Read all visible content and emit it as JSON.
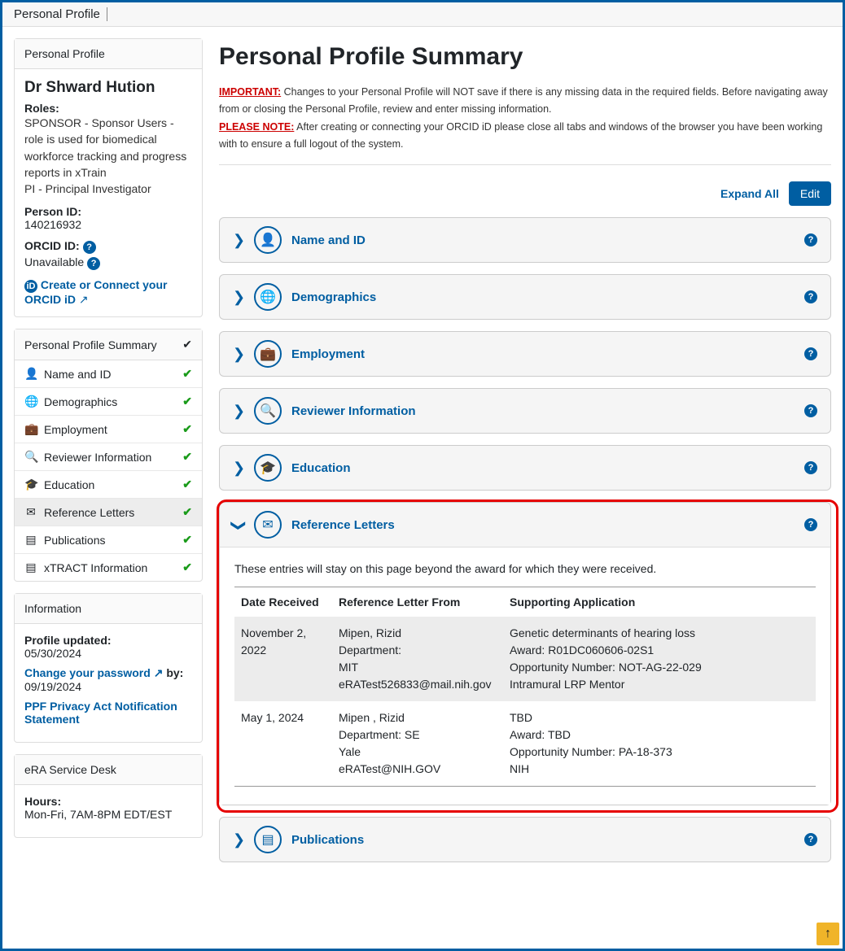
{
  "topbar": {
    "title": "Personal Profile"
  },
  "profile": {
    "header": "Personal Profile",
    "name": "Dr Shward Hution",
    "roles_label": "Roles:",
    "roles_text": "SPONSOR - Sponsor Users - role is used for biomedical workforce tracking and progress reports in xTrain\nPI - Principal Investigator",
    "person_id_label": "Person ID:",
    "person_id": "140216932",
    "orcid_label": "ORCID ID:",
    "orcid_status": "Unavailable",
    "orcid_link": "Create or Connect your ORCID iD"
  },
  "nav": {
    "header": "Personal Profile Summary",
    "items": [
      {
        "label": "Name and ID",
        "icon": "user-icon"
      },
      {
        "label": "Demographics",
        "icon": "globe-icon"
      },
      {
        "label": "Employment",
        "icon": "briefcase-icon"
      },
      {
        "label": "Reviewer Information",
        "icon": "search-icon"
      },
      {
        "label": "Education",
        "icon": "graduation-icon"
      },
      {
        "label": "Reference Letters",
        "icon": "envelope-icon"
      },
      {
        "label": "Publications",
        "icon": "book-icon"
      },
      {
        "label": "xTRACT Information",
        "icon": "book-icon"
      }
    ]
  },
  "info": {
    "header": "Information",
    "profile_updated_label": "Profile updated:",
    "profile_updated": "05/30/2024",
    "change_pw": "Change your password",
    "by_label": " by:",
    "by_date": "09/19/2024",
    "privacy_link": "PPF Privacy Act Notification Statement"
  },
  "service": {
    "header": "eRA Service Desk",
    "hours_label": "Hours:",
    "hours": "Mon-Fri, 7AM-8PM EDT/EST"
  },
  "main": {
    "title": "Personal Profile Summary",
    "important_label": "IMPORTANT:",
    "important_text": "  Changes to your Personal Profile will NOT save if there is any missing data in the required fields. Before navigating away from or closing the Personal Profile, review and enter missing information.",
    "please_label": "PLEASE NOTE:",
    "please_text": " After creating or connecting your ORCID iD please close all tabs and windows of the browser you have been working with to ensure a full logout of the system.",
    "expand_all": "Expand All",
    "edit": "Edit"
  },
  "sections": [
    {
      "title": "Name and ID"
    },
    {
      "title": "Demographics"
    },
    {
      "title": "Employment"
    },
    {
      "title": "Reviewer Information"
    },
    {
      "title": "Education"
    },
    {
      "title": "Reference Letters"
    },
    {
      "title": "Publications"
    }
  ],
  "reference_letters": {
    "hint": "These entries will stay on this page beyond the award for which they were received.",
    "headers": {
      "date": "Date Received",
      "from": "Reference Letter From",
      "supporting": "Supporting Application"
    },
    "rows": [
      {
        "date": "November 2, 2022",
        "from_name": "Mipen, Rizid",
        "from_dept": "Department:",
        "from_org": "MIT",
        "from_email": "eRATest526833@mail.nih.gov",
        "app_title": "Genetic determinants of hearing loss",
        "app_award": "Award: R01DC060606-02S1",
        "app_opp": "Opportunity Number: NOT-AG-22-029",
        "app_extra": "Intramural LRP Mentor"
      },
      {
        "date": "May 1, 2024",
        "from_name": "Mipen , Rizid",
        "from_dept": "Department: SE",
        "from_org": "Yale",
        "from_email": "eRATest@NIH.GOV",
        "app_title": "TBD",
        "app_award": "Award: TBD",
        "app_opp": "Opportunity Number: PA-18-373",
        "app_extra": "NIH"
      }
    ]
  }
}
